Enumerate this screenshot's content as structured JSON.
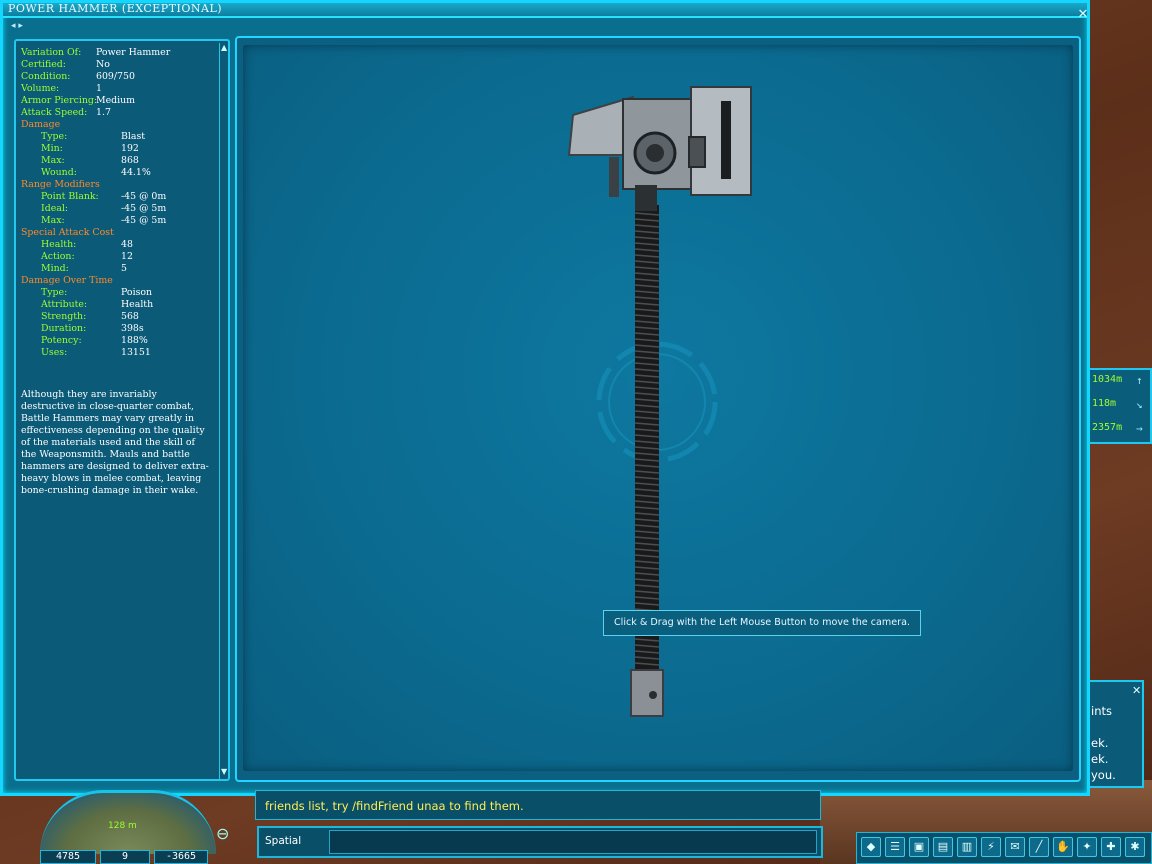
{
  "window": {
    "title": "POWER HAMMER (EXCEPTIONAL)",
    "close": "✕",
    "nav": "◂ ▸"
  },
  "stats": {
    "top": [
      {
        "k": "Variation Of:",
        "v": "Power Hammer"
      },
      {
        "k": "Certified:",
        "v": "No"
      },
      {
        "k": "Condition:",
        "v": "609/750"
      },
      {
        "k": "Volume:",
        "v": "1"
      },
      {
        "k": "Armor Piercing:",
        "v": "Medium"
      },
      {
        "k": "Attack Speed:",
        "v": "1.7"
      }
    ],
    "damage": {
      "title": "Damage",
      "rows": [
        {
          "k": "Type:",
          "v": "Blast"
        },
        {
          "k": "Min:",
          "v": "192"
        },
        {
          "k": "Max:",
          "v": "868"
        },
        {
          "k": "Wound:",
          "v": "44.1%"
        }
      ]
    },
    "range": {
      "title": "Range Modifiers",
      "rows": [
        {
          "k": "Point Blank:",
          "v": "-45 @  0m"
        },
        {
          "k": "Ideal:",
          "v": "-45 @  5m"
        },
        {
          "k": "Max:",
          "v": "-45 @  5m"
        }
      ]
    },
    "special": {
      "title": "Special Attack Cost",
      "rows": [
        {
          "k": "Health:",
          "v": "48"
        },
        {
          "k": "Action:",
          "v": "12"
        },
        {
          "k": "Mind:",
          "v": "5"
        }
      ]
    },
    "dot": {
      "title": "Damage Over Time",
      "rows": [
        {
          "k": "Type:",
          "v": "Poison"
        },
        {
          "k": "Attribute:",
          "v": "Health"
        },
        {
          "k": "Strength:",
          "v": "568"
        },
        {
          "k": "Duration:",
          "v": "398s"
        },
        {
          "k": "Potency:",
          "v": "188%"
        },
        {
          "k": "Uses:",
          "v": "13151"
        }
      ]
    }
  },
  "description": "Although they are invariably destructive in close-quarter combat, Battle Hammers may vary greatly in effectiveness depending on the quality of the materials used and the skill of the Weaponsmith.  Mauls and battle hammers are designed to deliver extra-heavy blows in melee combat, leaving bone-crushing damage in their wake.",
  "viewer": {
    "tooltip": "Click & Drag with the Left Mouse Button to move the camera."
  },
  "waypoints": [
    {
      "dist": "1034m",
      "arrow": "↑"
    },
    {
      "dist": "118m",
      "arrow": "↘"
    },
    {
      "dist": "2357m",
      "arrow": "→"
    }
  ],
  "chat_side": {
    "lines": [
      "ints",
      "ek.",
      "ek.",
      "you."
    ],
    "close": "✕"
  },
  "radar": {
    "distance": "128 m"
  },
  "coords": [
    "4785",
    "9",
    "-3665"
  ],
  "chat": {
    "output": "friends list, try /findFriend unaa  to find them.",
    "tab": "Spatial",
    "input_value": ""
  },
  "toolbar_icons": [
    "water-drop-icon",
    "list-icon",
    "inventory-icon",
    "mail-icon",
    "datapad-icon",
    "skills-icon",
    "envelope-icon",
    "sword-icon",
    "hand-icon",
    "paw-icon",
    "gear-icon",
    "star-icon"
  ],
  "toolbar_glyphs": [
    "◆",
    "☰",
    "▣",
    "▤",
    "▥",
    "⚡",
    "✉",
    "╱",
    "✋",
    "✦",
    "✚",
    "✱"
  ],
  "scroll": {
    "up": "▲",
    "down": "▼"
  },
  "colors": {
    "frame": "#15d6ff",
    "panel": "#0b5a78",
    "label": "#9cff2e",
    "section": "#ff8a2a",
    "chat_text": "#ffee55"
  }
}
